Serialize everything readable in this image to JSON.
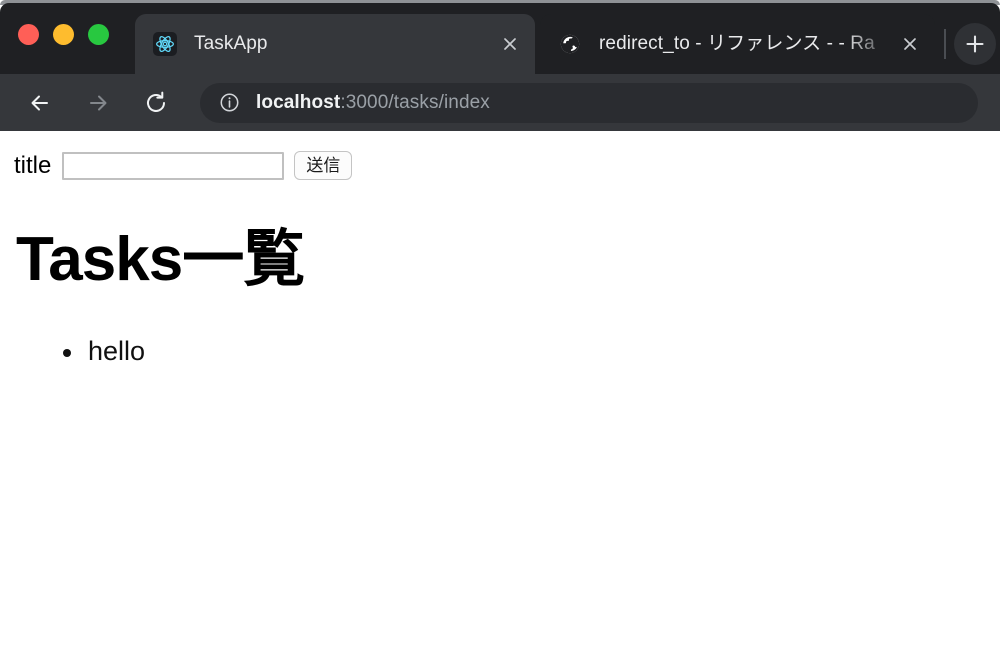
{
  "browser": {
    "window_controls": [
      {
        "name": "close",
        "color": "#ff5f57"
      },
      {
        "name": "minimize",
        "color": "#febc2e"
      },
      {
        "name": "maximize",
        "color": "#28c840"
      }
    ],
    "tabs": [
      {
        "title": "TaskApp",
        "favicon": "react-icon",
        "active": true,
        "close_label": "×"
      },
      {
        "title": "redirect_to - リファレンス - - Ra",
        "favicon": "globe-icon",
        "active": false,
        "close_label": "×"
      }
    ],
    "new_tab_label": "+",
    "toolbar": {
      "back_label": "←",
      "forward_label": "→",
      "reload_label": "↻",
      "info_label": "i",
      "url_host": "localhost",
      "url_path": ":3000/tasks/index"
    }
  },
  "page": {
    "form": {
      "label": "title",
      "input_value": "",
      "input_placeholder": "",
      "submit_label": "送信"
    },
    "heading": "Tasks一覧",
    "tasks": [
      {
        "title": "hello"
      }
    ]
  },
  "colors": {
    "tab_strip_bg": "#1f2023",
    "toolbar_bg": "#35373b",
    "active_tab_bg": "#35373b",
    "url_pill_bg": "#2a2c30",
    "page_bg": "#ffffff",
    "text_primary": "#000000"
  }
}
